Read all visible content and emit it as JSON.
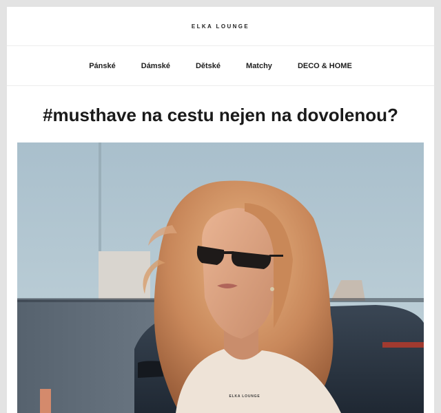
{
  "header": {
    "brand": "ELKA LOUNGE"
  },
  "nav": {
    "items": [
      {
        "label": "Pánské"
      },
      {
        "label": "Dámské"
      },
      {
        "label": "Dětské"
      },
      {
        "label": "Matchy"
      },
      {
        "label": "DECO & HOME"
      }
    ]
  },
  "article": {
    "title": "#musthave na cestu nejen na dovolenou?",
    "tshirt_print": "ELKA LOUNGE"
  }
}
